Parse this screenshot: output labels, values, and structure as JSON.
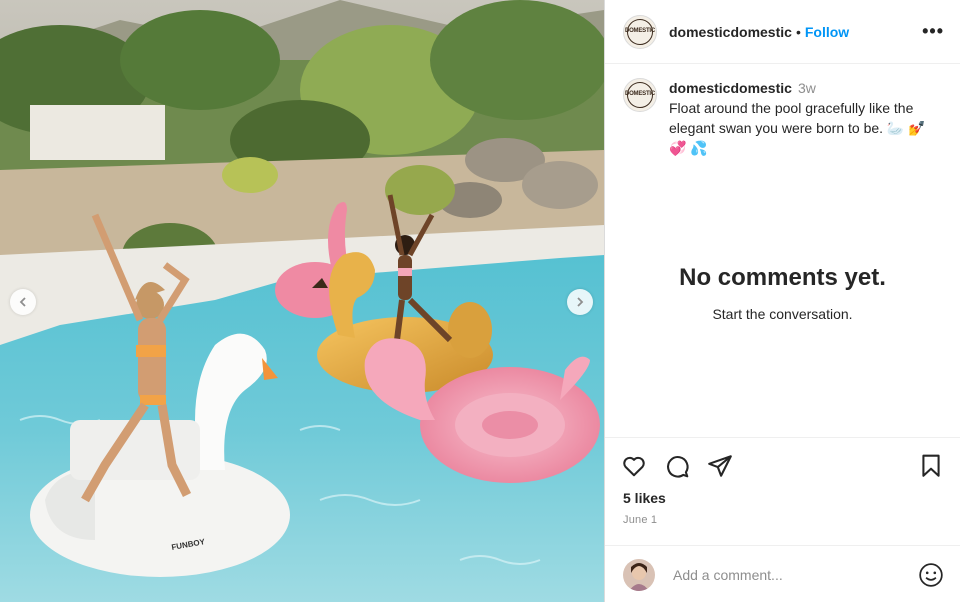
{
  "post": {
    "username": "domesticdomestic",
    "follow_label": "Follow",
    "separator": "•",
    "more_label": "•••",
    "avatar_text": "DOMESTIC",
    "float_brand": "FUNBOY"
  },
  "caption": {
    "username": "domesticdomestic",
    "time": "3w",
    "text": "Float around the pool gracefully like the elegant swan you were born to be. 🦢 💅",
    "text_line2": "💞 💦"
  },
  "comments": {
    "empty_title": "No comments yet.",
    "empty_subtitle": "Start the conversation."
  },
  "stats": {
    "likes": "5 likes",
    "date": "June 1"
  },
  "composer": {
    "placeholder": "Add a comment..."
  },
  "icons": [
    "chevron-left-icon",
    "chevron-right-icon",
    "heart-icon",
    "comment-icon",
    "share-icon",
    "bookmark-icon",
    "emoji-icon",
    "more-icon"
  ],
  "colors": {
    "accent": "#0095f6",
    "text": "#262626",
    "muted": "#8e8e8e",
    "border": "#dbdbdb"
  }
}
